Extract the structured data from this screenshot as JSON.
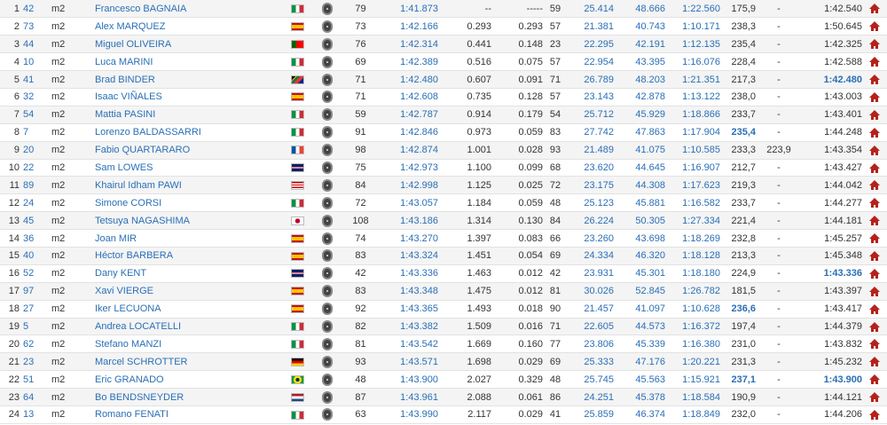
{
  "rows": [
    {
      "pos": "1",
      "num": "42",
      "cat": "m2",
      "rider": "Francesco BAGNAIA",
      "flag": "italy",
      "laps": "79",
      "time": "1:41.873",
      "gap": "--",
      "prev": "-----",
      "lap": "59",
      "s1": "25.414",
      "s2": "48.666",
      "s3": "1:22.560",
      "speed": "175,9",
      "speed_hl": false,
      "speed2": "-",
      "best": "1:42.540",
      "best_hl": false
    },
    {
      "pos": "2",
      "num": "73",
      "cat": "m2",
      "rider": "Alex MARQUEZ",
      "flag": "spain",
      "laps": "73",
      "time": "1:42.166",
      "gap": "0.293",
      "prev": "0.293",
      "lap": "57",
      "s1": "21.381",
      "s2": "40.743",
      "s3": "1:10.171",
      "speed": "238,3",
      "speed_hl": false,
      "speed2": "-",
      "best": "1:50.645",
      "best_hl": false
    },
    {
      "pos": "3",
      "num": "44",
      "cat": "m2",
      "rider": "Miguel OLIVEIRA",
      "flag": "portugal",
      "laps": "76",
      "time": "1:42.314",
      "gap": "0.441",
      "prev": "0.148",
      "lap": "23",
      "s1": "22.295",
      "s2": "42.191",
      "s3": "1:12.135",
      "speed": "235,4",
      "speed_hl": false,
      "speed2": "-",
      "best": "1:42.325",
      "best_hl": false
    },
    {
      "pos": "4",
      "num": "10",
      "cat": "m2",
      "rider": "Luca MARINI",
      "flag": "italy",
      "laps": "69",
      "time": "1:42.389",
      "gap": "0.516",
      "prev": "0.075",
      "lap": "57",
      "s1": "22.954",
      "s2": "43.395",
      "s3": "1:16.076",
      "speed": "228,4",
      "speed_hl": false,
      "speed2": "-",
      "best": "1:42.588",
      "best_hl": false
    },
    {
      "pos": "5",
      "num": "41",
      "cat": "m2",
      "rider": "Brad BINDER",
      "flag": "south-africa",
      "laps": "71",
      "time": "1:42.480",
      "gap": "0.607",
      "prev": "0.091",
      "lap": "71",
      "s1": "26.789",
      "s2": "48.203",
      "s3": "1:21.351",
      "speed": "217,3",
      "speed_hl": false,
      "speed2": "-",
      "best": "1:42.480",
      "best_hl": true
    },
    {
      "pos": "6",
      "num": "32",
      "cat": "m2",
      "rider": "Isaac VIÑALES",
      "flag": "spain",
      "laps": "71",
      "time": "1:42.608",
      "gap": "0.735",
      "prev": "0.128",
      "lap": "57",
      "s1": "23.143",
      "s2": "42.878",
      "s3": "1:13.122",
      "speed": "238,0",
      "speed_hl": false,
      "speed2": "-",
      "best": "1:43.003",
      "best_hl": false
    },
    {
      "pos": "7",
      "num": "54",
      "cat": "m2",
      "rider": "Mattia PASINI",
      "flag": "italy",
      "laps": "59",
      "time": "1:42.787",
      "gap": "0.914",
      "prev": "0.179",
      "lap": "54",
      "s1": "25.712",
      "s2": "45.929",
      "s3": "1:18.866",
      "speed": "233,7",
      "speed_hl": false,
      "speed2": "-",
      "best": "1:43.401",
      "best_hl": false
    },
    {
      "pos": "8",
      "num": "7",
      "cat": "m2",
      "rider": "Lorenzo BALDASSARRI",
      "flag": "italy",
      "laps": "91",
      "time": "1:42.846",
      "gap": "0.973",
      "prev": "0.059",
      "lap": "83",
      "s1": "27.742",
      "s2": "47.863",
      "s3": "1:17.904",
      "speed": "235,4",
      "speed_hl": true,
      "speed2": "-",
      "best": "1:44.248",
      "best_hl": false
    },
    {
      "pos": "9",
      "num": "20",
      "cat": "m2",
      "rider": "Fabio QUARTARARO",
      "flag": "france",
      "laps": "98",
      "time": "1:42.874",
      "gap": "1.001",
      "prev": "0.028",
      "lap": "93",
      "s1": "21.489",
      "s2": "41.075",
      "s3": "1:10.585",
      "speed": "233,3",
      "speed_hl": false,
      "speed2": "223,9",
      "best": "1:43.354",
      "best_hl": false
    },
    {
      "pos": "10",
      "num": "22",
      "cat": "m2",
      "rider": "Sam LOWES",
      "flag": "uk",
      "laps": "75",
      "time": "1:42.973",
      "gap": "1.100",
      "prev": "0.099",
      "lap": "68",
      "s1": "23.620",
      "s2": "44.645",
      "s3": "1:16.907",
      "speed": "212,7",
      "speed_hl": false,
      "speed2": "-",
      "best": "1:43.427",
      "best_hl": false
    },
    {
      "pos": "11",
      "num": "89",
      "cat": "m2",
      "rider": "Khairul Idham PAWI",
      "flag": "malaysia",
      "laps": "84",
      "time": "1:42.998",
      "gap": "1.125",
      "prev": "0.025",
      "lap": "72",
      "s1": "23.175",
      "s2": "44.308",
      "s3": "1:17.623",
      "speed": "219,3",
      "speed_hl": false,
      "speed2": "-",
      "best": "1:44.042",
      "best_hl": false
    },
    {
      "pos": "12",
      "num": "24",
      "cat": "m2",
      "rider": "Simone CORSI",
      "flag": "italy",
      "laps": "72",
      "time": "1:43.057",
      "gap": "1.184",
      "prev": "0.059",
      "lap": "48",
      "s1": "25.123",
      "s2": "45.881",
      "s3": "1:16.582",
      "speed": "233,7",
      "speed_hl": false,
      "speed2": "-",
      "best": "1:44.277",
      "best_hl": false
    },
    {
      "pos": "13",
      "num": "45",
      "cat": "m2",
      "rider": "Tetsuya NAGASHIMA",
      "flag": "japan",
      "laps": "108",
      "time": "1:43.186",
      "gap": "1.314",
      "prev": "0.130",
      "lap": "84",
      "s1": "26.224",
      "s2": "50.305",
      "s3": "1:27.334",
      "speed": "221,4",
      "speed_hl": false,
      "speed2": "-",
      "best": "1:44.181",
      "best_hl": false
    },
    {
      "pos": "14",
      "num": "36",
      "cat": "m2",
      "rider": "Joan MIR",
      "flag": "spain",
      "laps": "74",
      "time": "1:43.270",
      "gap": "1.397",
      "prev": "0.083",
      "lap": "66",
      "s1": "23.260",
      "s2": "43.698",
      "s3": "1:18.269",
      "speed": "232,8",
      "speed_hl": false,
      "speed2": "-",
      "best": "1:45.257",
      "best_hl": false
    },
    {
      "pos": "15",
      "num": "40",
      "cat": "m2",
      "rider": "Héctor BARBERA",
      "flag": "spain",
      "laps": "83",
      "time": "1:43.324",
      "gap": "1.451",
      "prev": "0.054",
      "lap": "69",
      "s1": "24.334",
      "s2": "46.320",
      "s3": "1:18.128",
      "speed": "213,3",
      "speed_hl": false,
      "speed2": "-",
      "best": "1:45.348",
      "best_hl": false
    },
    {
      "pos": "16",
      "num": "52",
      "cat": "m2",
      "rider": "Dany KENT",
      "flag": "uk",
      "laps": "42",
      "time": "1:43.336",
      "gap": "1.463",
      "prev": "0.012",
      "lap": "42",
      "s1": "23.931",
      "s2": "45.301",
      "s3": "1:18.180",
      "speed": "224,9",
      "speed_hl": false,
      "speed2": "-",
      "best": "1:43.336",
      "best_hl": true
    },
    {
      "pos": "17",
      "num": "97",
      "cat": "m2",
      "rider": "Xavi VIERGE",
      "flag": "spain",
      "laps": "83",
      "time": "1:43.348",
      "gap": "1.475",
      "prev": "0.012",
      "lap": "81",
      "s1": "30.026",
      "s2": "52.845",
      "s3": "1:26.782",
      "speed": "181,5",
      "speed_hl": false,
      "speed2": "-",
      "best": "1:43.397",
      "best_hl": false
    },
    {
      "pos": "18",
      "num": "27",
      "cat": "m2",
      "rider": "Iker LECUONA",
      "flag": "spain",
      "laps": "92",
      "time": "1:43.365",
      "gap": "1.493",
      "prev": "0.018",
      "lap": "90",
      "s1": "21.457",
      "s2": "41.097",
      "s3": "1:10.628",
      "speed": "236,6",
      "speed_hl": true,
      "speed2": "-",
      "best": "1:43.417",
      "best_hl": false
    },
    {
      "pos": "19",
      "num": "5",
      "cat": "m2",
      "rider": "Andrea LOCATELLI",
      "flag": "italy",
      "laps": "82",
      "time": "1:43.382",
      "gap": "1.509",
      "prev": "0.016",
      "lap": "71",
      "s1": "22.605",
      "s2": "44.573",
      "s3": "1:16.372",
      "speed": "197,4",
      "speed_hl": false,
      "speed2": "-",
      "best": "1:44.379",
      "best_hl": false
    },
    {
      "pos": "20",
      "num": "62",
      "cat": "m2",
      "rider": "Stefano MANZI",
      "flag": "italy",
      "laps": "81",
      "time": "1:43.542",
      "gap": "1.669",
      "prev": "0.160",
      "lap": "77",
      "s1": "23.806",
      "s2": "45.339",
      "s3": "1:16.380",
      "speed": "231,0",
      "speed_hl": false,
      "speed2": "-",
      "best": "1:43.832",
      "best_hl": false
    },
    {
      "pos": "21",
      "num": "23",
      "cat": "m2",
      "rider": "Marcel SCHROTTER",
      "flag": "germany",
      "laps": "93",
      "time": "1:43.571",
      "gap": "1.698",
      "prev": "0.029",
      "lap": "69",
      "s1": "25.333",
      "s2": "47.176",
      "s3": "1:20.221",
      "speed": "231,3",
      "speed_hl": false,
      "speed2": "-",
      "best": "1:45.232",
      "best_hl": false
    },
    {
      "pos": "22",
      "num": "51",
      "cat": "m2",
      "rider": "Eric GRANADO",
      "flag": "brazil",
      "laps": "48",
      "time": "1:43.900",
      "gap": "2.027",
      "prev": "0.329",
      "lap": "48",
      "s1": "25.745",
      "s2": "45.563",
      "s3": "1:15.921",
      "speed": "237,1",
      "speed_hl": true,
      "speed2": "-",
      "best": "1:43.900",
      "best_hl": true
    },
    {
      "pos": "23",
      "num": "64",
      "cat": "m2",
      "rider": "Bo BENDSNEYDER",
      "flag": "netherlands",
      "laps": "87",
      "time": "1:43.961",
      "gap": "2.088",
      "prev": "0.061",
      "lap": "86",
      "s1": "24.251",
      "s2": "45.378",
      "s3": "1:18.584",
      "speed": "190,9",
      "speed_hl": false,
      "speed2": "-",
      "best": "1:44.121",
      "best_hl": false
    },
    {
      "pos": "24",
      "num": "13",
      "cat": "m2",
      "rider": "Romano FENATI",
      "flag": "italy",
      "laps": "63",
      "time": "1:43.990",
      "gap": "2.117",
      "prev": "0.029",
      "lap": "41",
      "s1": "25.859",
      "s2": "46.374",
      "s3": "1:18.849",
      "speed": "232,0",
      "speed_hl": false,
      "speed2": "-",
      "best": "1:44.206",
      "best_hl": false
    }
  ],
  "colors": {
    "link": "#2a6fb6",
    "home": "#b5221b",
    "row_alt": "#f4f4f4"
  }
}
